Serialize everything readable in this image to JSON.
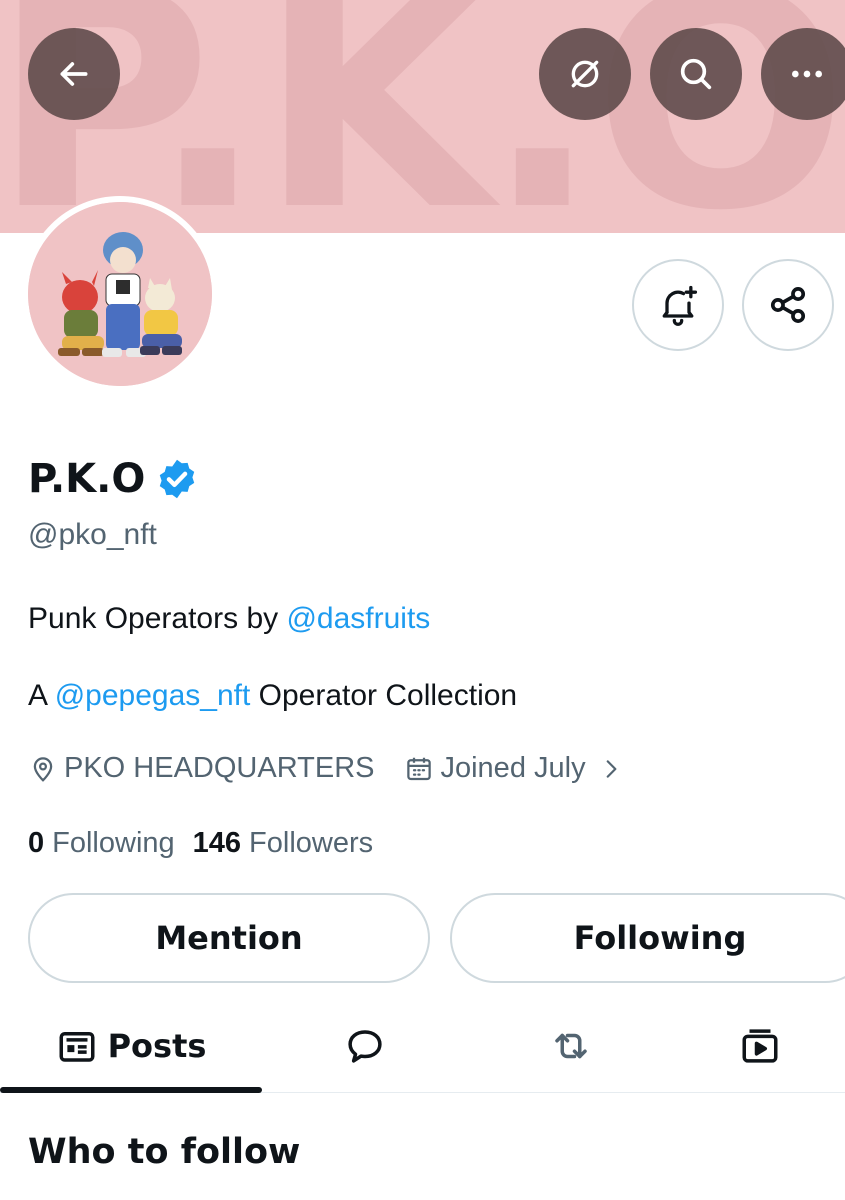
{
  "banner": {
    "text": "P.K.O"
  },
  "header": {
    "back_icon": "arrow-left-icon",
    "grok_icon": "grok-icon",
    "search_icon": "search-icon",
    "more_icon": "more-icon"
  },
  "profile": {
    "name": "P.K.O",
    "handle": "@pko_nft",
    "verified": true,
    "bio_line1_prefix": "Punk Operators by ",
    "bio_line1_mention": "@dasfruits",
    "bio_line2_prefix": "A ",
    "bio_line2_mention": "@pepegas_nft",
    "bio_line2_suffix": " Operator Collection",
    "location": "PKO HEADQUARTERS",
    "joined": "Joined July",
    "following_count": "0",
    "following_label": "Following",
    "followers_count": "146",
    "followers_label": "Followers"
  },
  "actions": {
    "notify_icon": "bell-plus-icon",
    "share_icon": "share-icon",
    "mention_label": "Mention",
    "following_label": "Following"
  },
  "tabs": {
    "posts_label": "Posts",
    "replies_icon": "speech-bubble-icon",
    "reposts_icon": "repost-icon",
    "media_icon": "video-icon"
  },
  "section": {
    "who_to_follow": "Who to follow"
  },
  "colors": {
    "banner": "#f0c3c5",
    "link": "#1d9bf0",
    "verified": "#1d9bf0",
    "text": "#0f1419",
    "muted": "#536471"
  }
}
